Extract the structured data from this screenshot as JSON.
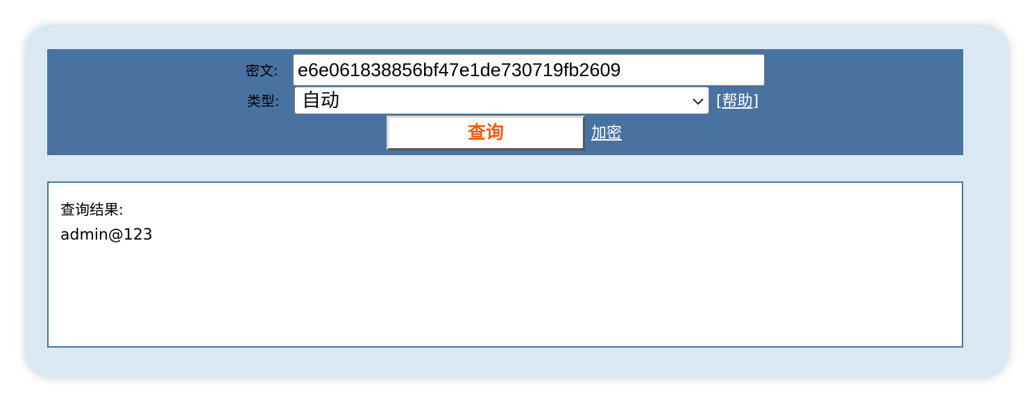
{
  "query_form": {
    "cipher_label": "密文:",
    "cipher_value": "e6e061838856bf47e1de730719fb2609",
    "type_label": "类型:",
    "type_selected": "自动",
    "help_link": "[帮助]",
    "help_bracket_open": "[",
    "help_text": "帮助",
    "help_bracket_close": "]",
    "query_button": "查询",
    "encrypt_link": "加密"
  },
  "result": {
    "label": "查询结果:",
    "value": "admin@123"
  },
  "colors": {
    "window_bg": "#d9e8f3",
    "panel_bg": "#4a72a0",
    "button_text": "#f15a12"
  }
}
